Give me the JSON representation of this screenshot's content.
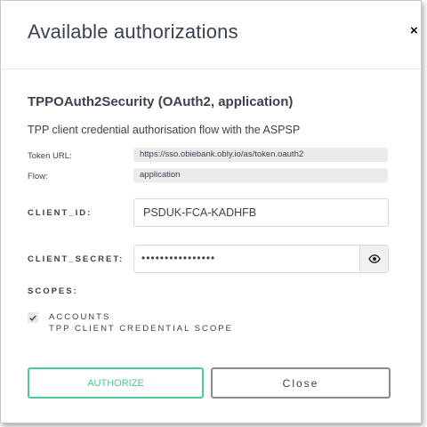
{
  "modal": {
    "title": "Available authorizations",
    "close_icon_glyph": "×"
  },
  "scheme": {
    "title": "TPPOAuth2Security (OAuth2, application)",
    "description": "TPP client credential authorisation flow with the ASPSP",
    "token_url_label": "Token URL:",
    "token_url": "https://sso.obiebank.obly.io/as/token.oauth2",
    "flow_label": "Flow:",
    "flow": "application"
  },
  "form": {
    "client_id_label": "CLIENT_ID:",
    "client_id_value": "PSDUK-FCA-KADHFB",
    "client_secret_label": "CLIENT_SECRET:",
    "client_secret_masked": "••••••••••••••••",
    "scopes_label": "SCOPES:"
  },
  "scopes": [
    {
      "name": "ACCOUNTS",
      "description": "TPP CLIENT CREDENTIAL SCOPE",
      "checked": true
    }
  ],
  "buttons": {
    "authorize": "AUTHORIZE",
    "close": "Close"
  },
  "colors": {
    "authorize_accent": "#49cc90",
    "text": "#3b4151"
  },
  "icons": {
    "close": "close-icon",
    "eye": "eye-icon",
    "check": "check-icon"
  }
}
